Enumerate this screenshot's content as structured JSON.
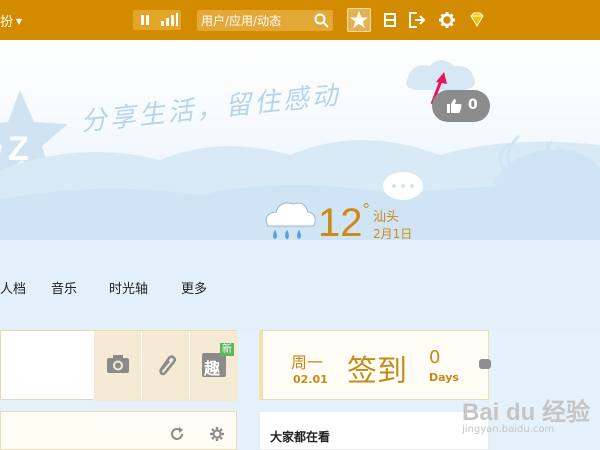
{
  "topbar": {
    "profile_label": "扮",
    "search_placeholder": "用户/应用/动态",
    "icons": [
      "pause-icon",
      "equalizer-icon",
      "search-icon",
      "star-icon",
      "bookmark-icon",
      "logout-icon",
      "gear-icon",
      "diamond-icon"
    ]
  },
  "banner": {
    "slogan": "分享生活，留住感动",
    "like_count": "0",
    "weather": {
      "temperature": "12",
      "degree": "°",
      "city": "汕头",
      "date": "2月1日"
    }
  },
  "nav": {
    "items": [
      "人档",
      "音乐",
      "时光轴",
      "更多"
    ]
  },
  "postbox": {
    "new_badge": "新",
    "fun_label": "趣"
  },
  "checkin": {
    "weekday": "周一",
    "date": "02.01",
    "sign_label": "签到",
    "days_count": "0",
    "days_unit": "Days"
  },
  "hot": {
    "title": "大家都在看"
  },
  "watermark": {
    "brand": "Bai du 经验",
    "url": "jingyan.baidu.com"
  },
  "colors": {
    "topbar": "#d38b00",
    "accent": "#cd8a14",
    "annotation_arrow": "#e8145a"
  }
}
